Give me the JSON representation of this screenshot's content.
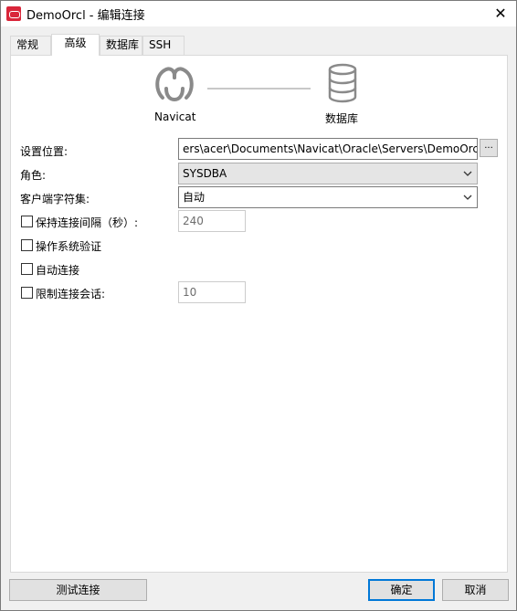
{
  "window": {
    "title": "DemoOrcl - 编辑连接",
    "close": "✕"
  },
  "tabs": [
    {
      "label": "常规",
      "active": false
    },
    {
      "label": "高级",
      "active": true
    },
    {
      "label": "数据库",
      "active": false
    },
    {
      "label": "SSH",
      "active": false
    }
  ],
  "diagram": {
    "left_label": "Navicat",
    "right_label": "数据库",
    "left_icon": "navicat-logo-icon",
    "right_icon": "database-icon"
  },
  "form": {
    "settings_location": {
      "label": "设置位置:",
      "value": "ers\\acer\\Documents\\Navicat\\Oracle\\Servers\\DemoOrcl",
      "browse": "..."
    },
    "role": {
      "label": "角色:",
      "value": "SYSDBA"
    },
    "client_charset": {
      "label": "客户端字符集:",
      "value": "自动"
    },
    "keepalive": {
      "label": "保持连接间隔（秒）:",
      "value": "240",
      "checked": false
    },
    "os_auth": {
      "label": "操作系统验证",
      "checked": false
    },
    "auto_connect": {
      "label": "自动连接",
      "checked": false
    },
    "limit_sessions": {
      "label": "限制连接会话:",
      "value": "10",
      "checked": false
    }
  },
  "buttons": {
    "test": "测试连接",
    "ok": "确定",
    "cancel": "取消"
  },
  "colors": {
    "accent": "#0078d7",
    "app_icon": "#d9263a"
  }
}
